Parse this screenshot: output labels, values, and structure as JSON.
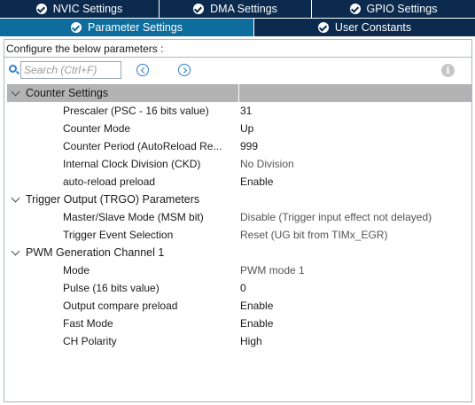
{
  "tabs_top": [
    {
      "label": "NVIC Settings"
    },
    {
      "label": "DMA Settings"
    },
    {
      "label": "GPIO Settings"
    }
  ],
  "tabs_bottom": [
    {
      "label": "Parameter Settings",
      "active": true
    },
    {
      "label": "User Constants",
      "active": false
    }
  ],
  "config_title": "Configure the below parameters :",
  "search": {
    "placeholder": "Search (Ctrl+F)",
    "value": ""
  },
  "colors": {
    "tab_dark": "#0b2a4d",
    "tab_active": "#0f6d9e",
    "section_selected": "#b3b3b3",
    "accent": "#2d7fd3"
  },
  "sections": [
    {
      "label": "Counter Settings",
      "params": [
        {
          "name": "Prescaler (PSC - 16 bits value)",
          "value": "31"
        },
        {
          "name": "Counter Mode",
          "value": "Up"
        },
        {
          "name": "Counter Period (AutoReload Re...",
          "value": "999"
        },
        {
          "name": "Internal Clock Division (CKD)",
          "value": "No Division"
        },
        {
          "name": "auto-reload preload",
          "value": "Enable"
        }
      ]
    },
    {
      "label": "Trigger Output (TRGO) Parameters",
      "params": [
        {
          "name": "Master/Slave Mode (MSM bit)",
          "value": "Disable (Trigger input effect not delayed)"
        },
        {
          "name": "Trigger Event Selection",
          "value": "Reset (UG bit from TIMx_EGR)"
        }
      ]
    },
    {
      "label": "PWM Generation Channel 1",
      "params": [
        {
          "name": "Mode",
          "value": "PWM mode 1"
        },
        {
          "name": "Pulse (16 bits value)",
          "value": "0"
        },
        {
          "name": "Output compare preload",
          "value": "Enable"
        },
        {
          "name": "Fast Mode",
          "value": "Enable"
        },
        {
          "name": "CH Polarity",
          "value": "High"
        }
      ]
    }
  ]
}
